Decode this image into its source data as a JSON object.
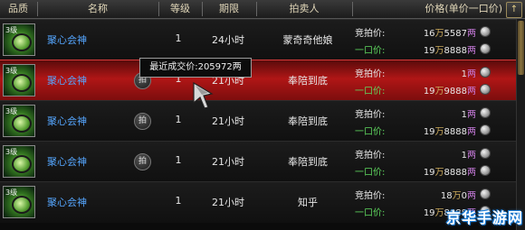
{
  "header": {
    "quality": "品质",
    "name": "名称",
    "grade": "等级",
    "time_limit": "期限",
    "seller": "拍卖人",
    "price": "价格(单价一口价)",
    "sort_icon": "sort-up-icon",
    "sort_glyph": "↑"
  },
  "rows": [
    {
      "level": "3级",
      "name": "聚心会神",
      "badge": "",
      "grade": "1",
      "time": "24小时",
      "seller": "蒙奇奇他娘",
      "bid_label": "竞拍价:",
      "bid_wan": "16",
      "bid_rest": "5587",
      "buy_label": "一口价:",
      "buy_wan": "19",
      "buy_rest": "8888",
      "currency": "两",
      "wan_unit": "万"
    },
    {
      "level": "3级",
      "name": "聚心会神",
      "badge": "拍",
      "grade": "1",
      "time": "21小时",
      "seller": "奉陪到底",
      "bid_label": "竞拍价:",
      "bid_wan": "",
      "bid_rest": "1",
      "buy_label": "一口价:",
      "buy_wan": "19",
      "buy_rest": "9888",
      "currency": "两",
      "wan_unit": "万"
    },
    {
      "level": "3级",
      "name": "聚心会神",
      "badge": "拍",
      "grade": "1",
      "time": "21小时",
      "seller": "奉陪到底",
      "bid_label": "竞拍价:",
      "bid_wan": "",
      "bid_rest": "1",
      "buy_label": "一口价:",
      "buy_wan": "19",
      "buy_rest": "8888",
      "currency": "两",
      "wan_unit": "万"
    },
    {
      "level": "3级",
      "name": "聚心会神",
      "badge": "拍",
      "grade": "1",
      "time": "21小时",
      "seller": "奉陪到底",
      "bid_label": "竞拍价:",
      "bid_wan": "",
      "bid_rest": "1",
      "buy_label": "一口价:",
      "buy_wan": "19",
      "buy_rest": "8888",
      "currency": "两",
      "wan_unit": "万"
    },
    {
      "level": "3级",
      "name": "聚心会神",
      "badge": "",
      "grade": "1",
      "time": "21小时",
      "seller": "知乎",
      "bid_label": "竞拍价:",
      "bid_wan": "18",
      "bid_rest": "0",
      "buy_label": "一口价:",
      "buy_wan": "19",
      "buy_rest": "8888",
      "currency": "两",
      "wan_unit": "万"
    }
  ],
  "tooltip": {
    "text": "最近成交价:205972两"
  },
  "colors": {
    "name": "#55a6ff",
    "buy_label": "#5fd85f",
    "selected_row": "#b01616",
    "wan": "#c9a85a",
    "liang": "#c77adb"
  },
  "watermark": {
    "text": "京华手游网"
  }
}
